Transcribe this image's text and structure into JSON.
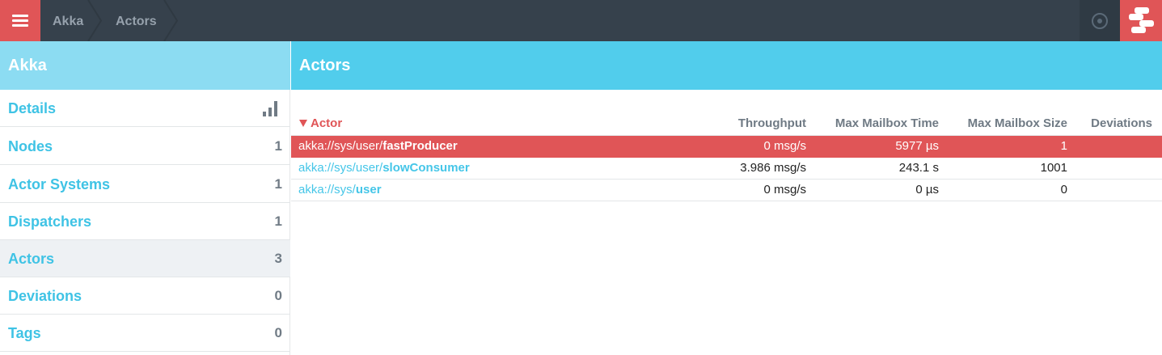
{
  "topbar": {
    "menu_icon": "hamburger-icon",
    "breadcrumbs": [
      "Akka",
      "Actors"
    ],
    "record_icon": "record-icon",
    "logo_icon": "logo-icon"
  },
  "sidebar": {
    "title": "Akka",
    "items": [
      {
        "label": "Details",
        "count": "",
        "icon": "bar-chart-icon"
      },
      {
        "label": "Nodes",
        "count": "1"
      },
      {
        "label": "Actor Systems",
        "count": "1"
      },
      {
        "label": "Dispatchers",
        "count": "1"
      },
      {
        "label": "Actors",
        "count": "3"
      },
      {
        "label": "Deviations",
        "count": "0"
      },
      {
        "label": "Tags",
        "count": "0"
      }
    ]
  },
  "main": {
    "title": "Actors",
    "columns": {
      "actor": "Actor",
      "throughput": "Throughput",
      "max_mailbox_time": "Max Mailbox Time",
      "max_mailbox_size": "Max Mailbox Size",
      "deviations": "Deviations"
    },
    "rows": [
      {
        "prefix": "akka://sys/user/",
        "name": "fastProducer",
        "throughput": "0 msg/s",
        "max_mailbox_time": "5977 µs",
        "max_mailbox_size": "1",
        "deviations": ""
      },
      {
        "prefix": "akka://sys/user/",
        "name": "slowConsumer",
        "throughput": "3.986 msg/s",
        "max_mailbox_time": "243.1 s",
        "max_mailbox_size": "1001",
        "deviations": ""
      },
      {
        "prefix": "akka://sys/",
        "name": "user",
        "throughput": "0 msg/s",
        "max_mailbox_time": "0 µs",
        "max_mailbox_size": "0",
        "deviations": ""
      }
    ]
  },
  "colors": {
    "accent_red": "#e05557",
    "topbar": "#36414c",
    "link_blue": "#45c6e8",
    "header_blue": "#51cdec",
    "sidebar_header_blue": "#8cdcf2"
  }
}
